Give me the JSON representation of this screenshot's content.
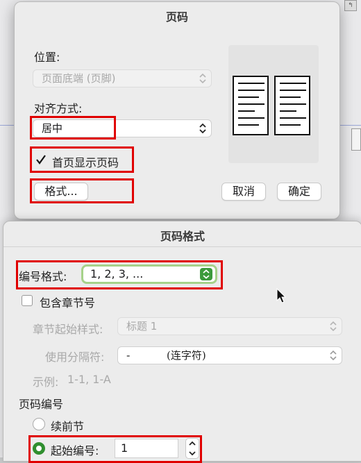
{
  "page_number_dialog": {
    "title": "页码",
    "position_label": "位置:",
    "position_value": "页面底端 (页脚)",
    "alignment_label": "对齐方式:",
    "alignment_value": "居中",
    "show_on_first_page_label": "首页显示页码",
    "show_on_first_page_checked": true,
    "format_button": "格式...",
    "cancel_button": "取消",
    "ok_button": "确定"
  },
  "format_dialog": {
    "title": "页码格式",
    "number_format_label": "编号格式:",
    "number_format_value": "1, 2, 3, ...",
    "include_chapter_label": "包含章节号",
    "chapter_style_label": "章节起始样式:",
    "chapter_style_value": "标题 1",
    "separator_label": "使用分隔符:",
    "separator_value": "-",
    "separator_desc": "(连字符)",
    "example_label": "示例:",
    "example_value": "1-1, 1-A",
    "numbering_section_label": "页码编号",
    "continue_label": "续前节",
    "start_at_label": "起始编号:",
    "start_at_value": "1"
  },
  "colors": {
    "highlight": "#e00000",
    "green_accent": "#3c9a3c"
  }
}
